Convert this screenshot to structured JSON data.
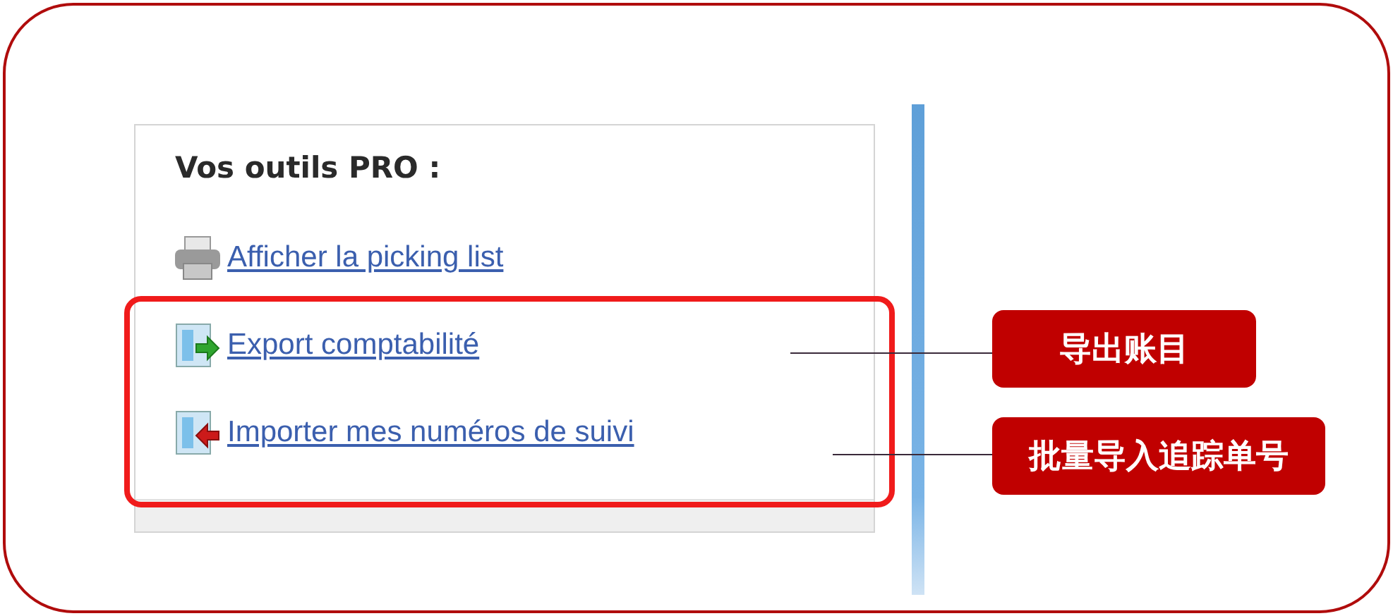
{
  "panel": {
    "title": "Vos outils PRO :",
    "links": [
      {
        "kind": "print",
        "label": "Afficher la picking list"
      },
      {
        "kind": "export",
        "label": "Export comptabilité"
      },
      {
        "kind": "import",
        "label": "Importer mes numéros de suivi"
      }
    ]
  },
  "annotations": [
    {
      "label": "导出账目"
    },
    {
      "label": "批量导入追踪单号"
    }
  ]
}
